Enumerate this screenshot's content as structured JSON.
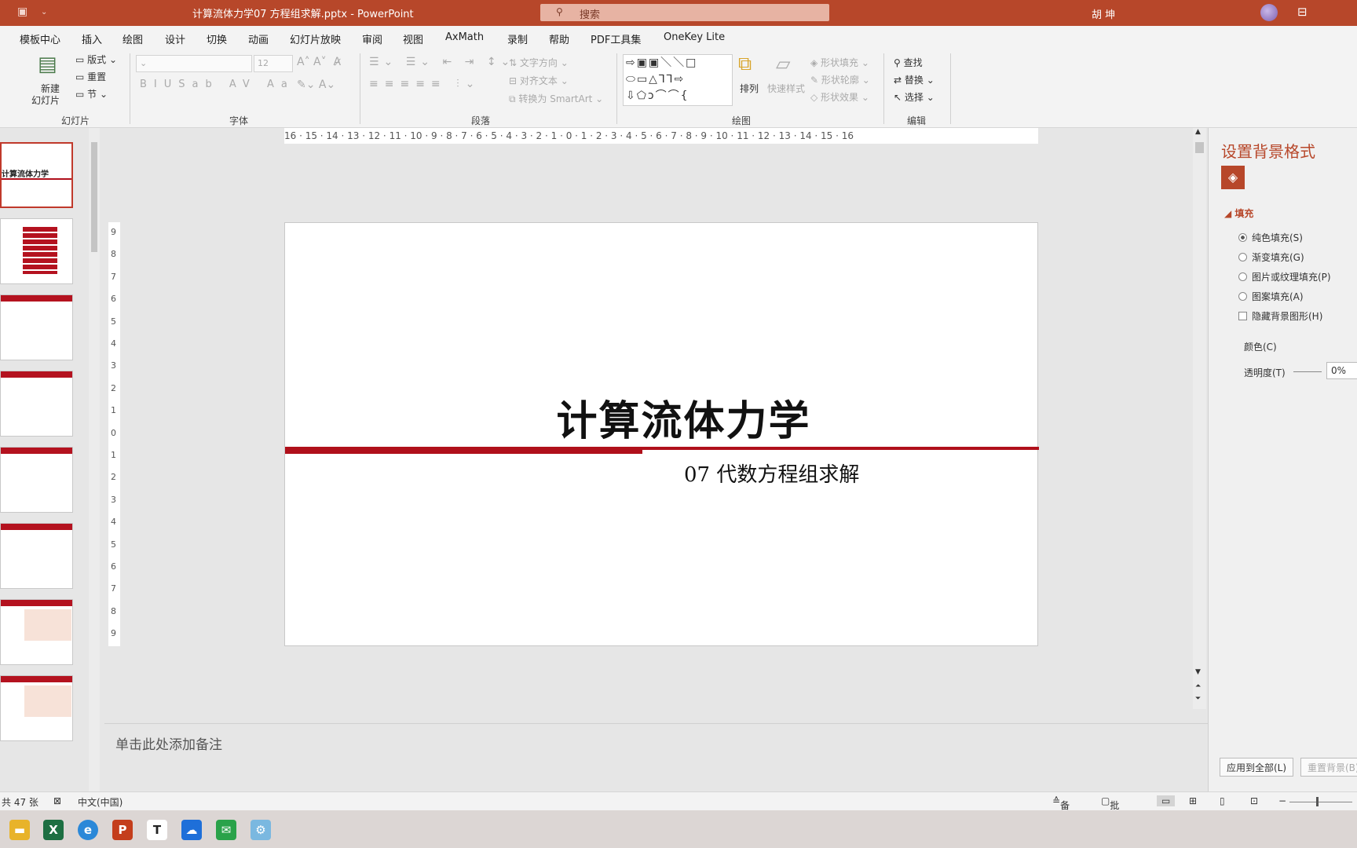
{
  "titlebar": {
    "doc_title": "计算流体力学07 方程组求解.pptx  -  PowerPoint",
    "search_placeholder": "搜索",
    "user": "胡 坤"
  },
  "menu": [
    "模板中心",
    "插入",
    "绘图",
    "设计",
    "切换",
    "动画",
    "幻灯片放映",
    "审阅",
    "视图",
    "AxMath",
    "录制",
    "帮助",
    "PDF工具集",
    "OneKey Lite"
  ],
  "ribbon": {
    "slides": {
      "new_slide": "新建",
      "new_slide2": "幻灯片",
      "layout": "版式",
      "reset": "重置",
      "section": "节",
      "group": "幻灯片"
    },
    "font": {
      "size": "12",
      "group": "字体"
    },
    "paragraph": {
      "text_dir": "文字方向",
      "align_text": "对齐文本",
      "smartart": "转换为 SmartArt",
      "group": "段落"
    },
    "drawing": {
      "arrange": "排列",
      "quick_style": "快速样式",
      "shape_fill": "形状填充",
      "shape_outline": "形状轮廓",
      "shape_effect": "形状效果",
      "group": "绘图"
    },
    "editing": {
      "find": "查找",
      "replace": "替换",
      "select": "选择",
      "group": "编辑"
    }
  },
  "thumbnails": {
    "slide1_title": "计算流体力学"
  },
  "slide": {
    "title": "计算流体力学",
    "subtitle": "07 代数方程组求解"
  },
  "notes": {
    "placeholder": "单击此处添加备注"
  },
  "pane": {
    "title": "设置背景格式",
    "section": "填充",
    "options": [
      "纯色填充(S)",
      "渐变填充(G)",
      "图片或纹理填充(P)",
      "图案填充(A)"
    ],
    "hide_bg": "隐藏背景图形(H)",
    "color": "颜色(C)",
    "transparency": "透明度(T)",
    "transparency_value": "0%",
    "apply_all": "应用到全部(L)",
    "reset_bg": "重置背景(B)"
  },
  "status": {
    "slide_count": "共 47 张",
    "language": "中文(中国)",
    "notes": "备注",
    "comments": "批注"
  },
  "hruler_text": "16 · 15 · 14 · 13 · 12 · 11 · 10 · 9 · 8 · 7 · 6 · 5 · 4 · 3 · 2 · 1 · 0 · 1 · 2 · 3 · 4 · 5 · 6 · 7 · 8 · 9 · 10 · 11 · 12 · 13 · 14 · 15 · 16",
  "vruler": [
    "9",
    "8",
    "7",
    "6",
    "5",
    "4",
    "3",
    "2",
    "1",
    "0",
    "1",
    "2",
    "3",
    "4",
    "5",
    "6",
    "7",
    "8",
    "9"
  ],
  "colors": {
    "accent": "#b7472a",
    "slide_red": "#b0101b"
  }
}
